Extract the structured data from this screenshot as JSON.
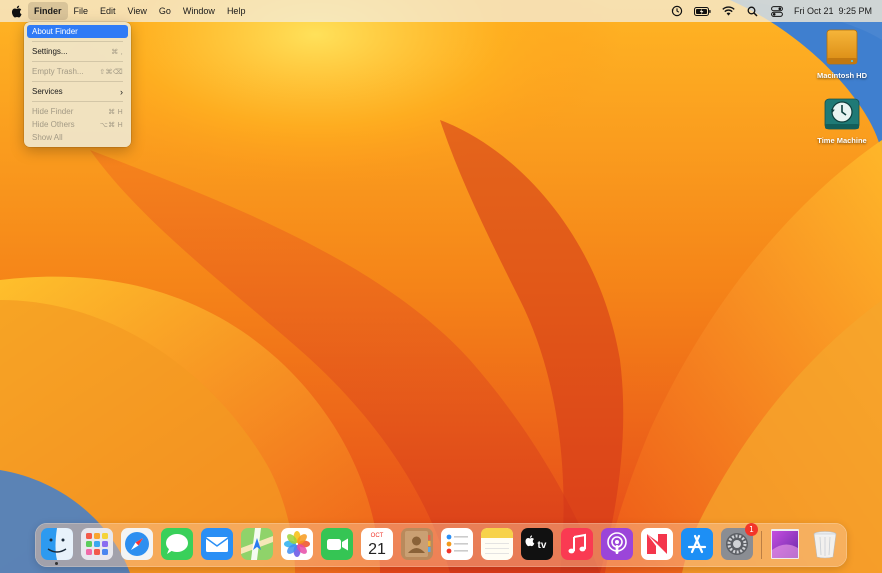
{
  "menubar": {
    "apple_icon": "apple-logo-icon",
    "items": [
      {
        "label": "Finder",
        "bold": true,
        "active": true
      },
      {
        "label": "File"
      },
      {
        "label": "Edit"
      },
      {
        "label": "View"
      },
      {
        "label": "Go"
      },
      {
        "label": "Window"
      },
      {
        "label": "Help"
      }
    ],
    "status": {
      "icons": [
        "time-machine-status-icon",
        "battery-icon",
        "wifi-icon",
        "spotlight-icon",
        "control-center-icon"
      ],
      "clock": "Fri Oct 21  9:25 PM"
    }
  },
  "finder_menu": {
    "items": [
      {
        "label": "About Finder",
        "shortcut": "",
        "highlighted": true
      },
      {
        "label": "Settings...",
        "shortcut": "⌘ ,"
      },
      {
        "label": "Empty Trash...",
        "shortcut": "⇧⌘⌫",
        "disabled": true
      },
      {
        "label": "Services",
        "submenu": true
      },
      {
        "label": "Hide Finder",
        "shortcut": "⌘ H",
        "disabled": true
      },
      {
        "label": "Hide Others",
        "shortcut": "⌥⌘ H",
        "disabled": true
      },
      {
        "label": "Show All",
        "disabled": true
      }
    ]
  },
  "desktop": {
    "icons": [
      {
        "label": "Macintosh HD",
        "icon": "hard-drive-icon"
      },
      {
        "label": "Time Machine",
        "icon": "time-machine-icon"
      }
    ]
  },
  "dock": {
    "apps": [
      {
        "name": "Finder",
        "icon": "finder-icon",
        "running": true
      },
      {
        "name": "Launchpad",
        "icon": "launchpad-icon"
      },
      {
        "name": "Safari",
        "icon": "safari-icon"
      },
      {
        "name": "Messages",
        "icon": "messages-icon"
      },
      {
        "name": "Mail",
        "icon": "mail-icon"
      },
      {
        "name": "Maps",
        "icon": "maps-icon"
      },
      {
        "name": "Photos",
        "icon": "photos-icon"
      },
      {
        "name": "FaceTime",
        "icon": "facetime-icon"
      },
      {
        "name": "Calendar",
        "icon": "calendar-icon",
        "month": "OCT",
        "day": "21"
      },
      {
        "name": "Contacts",
        "icon": "contacts-icon"
      },
      {
        "name": "Reminders",
        "icon": "reminders-icon"
      },
      {
        "name": "Notes",
        "icon": "notes-icon"
      },
      {
        "name": "TV",
        "icon": "apple-tv-icon",
        "label": "tv"
      },
      {
        "name": "Music",
        "icon": "music-icon"
      },
      {
        "name": "Podcasts",
        "icon": "podcasts-icon"
      },
      {
        "name": "News",
        "icon": "news-icon"
      },
      {
        "name": "App Store",
        "icon": "app-store-icon"
      },
      {
        "name": "System Settings",
        "icon": "system-settings-icon",
        "badge": "1"
      },
      {
        "name": "Downloads",
        "icon": "downloads-stack-icon"
      },
      {
        "name": "Trash",
        "icon": "trash-icon"
      }
    ]
  },
  "colors": {
    "highlight": "#2f7bf6",
    "wallpaper_orange": "#f07a1c",
    "wallpaper_blue": "#3f7fcf"
  }
}
